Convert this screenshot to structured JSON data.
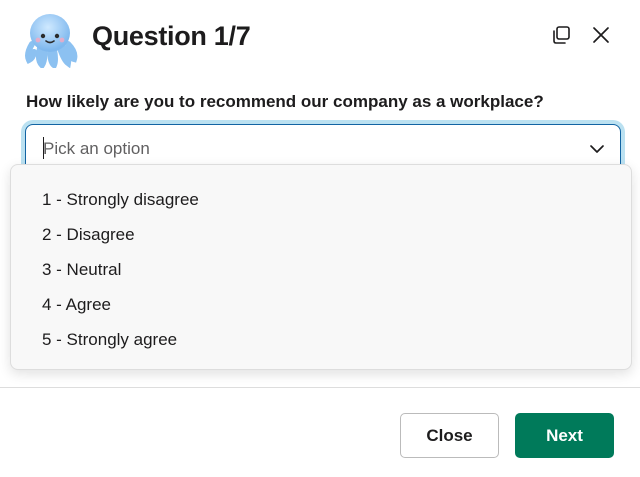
{
  "modal": {
    "title": "Question 1/7",
    "avatar_icon": "octopus-icon",
    "expand_icon": "expand-window-icon",
    "close_icon": "close-icon"
  },
  "question": {
    "text": "How likely are you to recommend our company as a workplace?"
  },
  "select": {
    "placeholder": "Pick an option",
    "chevron_icon": "chevron-down-icon",
    "focus_color": "#1264a3",
    "options": [
      "1 - Strongly disagree",
      "2 - Disagree",
      "3 - Neutral",
      "4 - Agree",
      "5 - Strongly agree"
    ]
  },
  "footer": {
    "close_label": "Close",
    "next_label": "Next",
    "next_color": "#007a5a"
  }
}
